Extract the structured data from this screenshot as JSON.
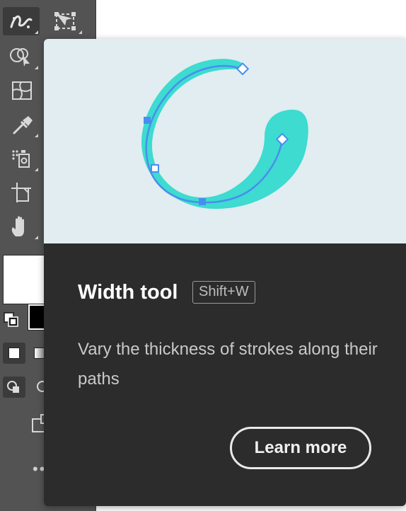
{
  "toolbar": {
    "tools": [
      {
        "name": "width-tool-icon",
        "selected": true
      },
      {
        "name": "free-transform-tool-icon",
        "selected": false
      },
      {
        "name": "shape-builder-tool-icon",
        "selected": false
      },
      {
        "name": "mesh-tool-icon",
        "selected": false
      },
      {
        "name": "eyedropper-tool-icon",
        "selected": false
      },
      {
        "name": "symbol-sprayer-tool-icon",
        "selected": false
      },
      {
        "name": "artboard-tool-icon",
        "selected": false
      },
      {
        "name": "hand-tool-icon",
        "selected": false
      }
    ],
    "fill_color": "#ffffff",
    "stroke_color": "#000000",
    "more_label": "••"
  },
  "tooltip": {
    "title": "Width tool",
    "shortcut": "Shift+W",
    "description": "Vary the thickness of strokes along their paths",
    "learn_more_label": "Learn more",
    "preview_background": "#e1edf1",
    "stroke_color": "#3ddbd0",
    "path_color": "#4a8df0"
  }
}
